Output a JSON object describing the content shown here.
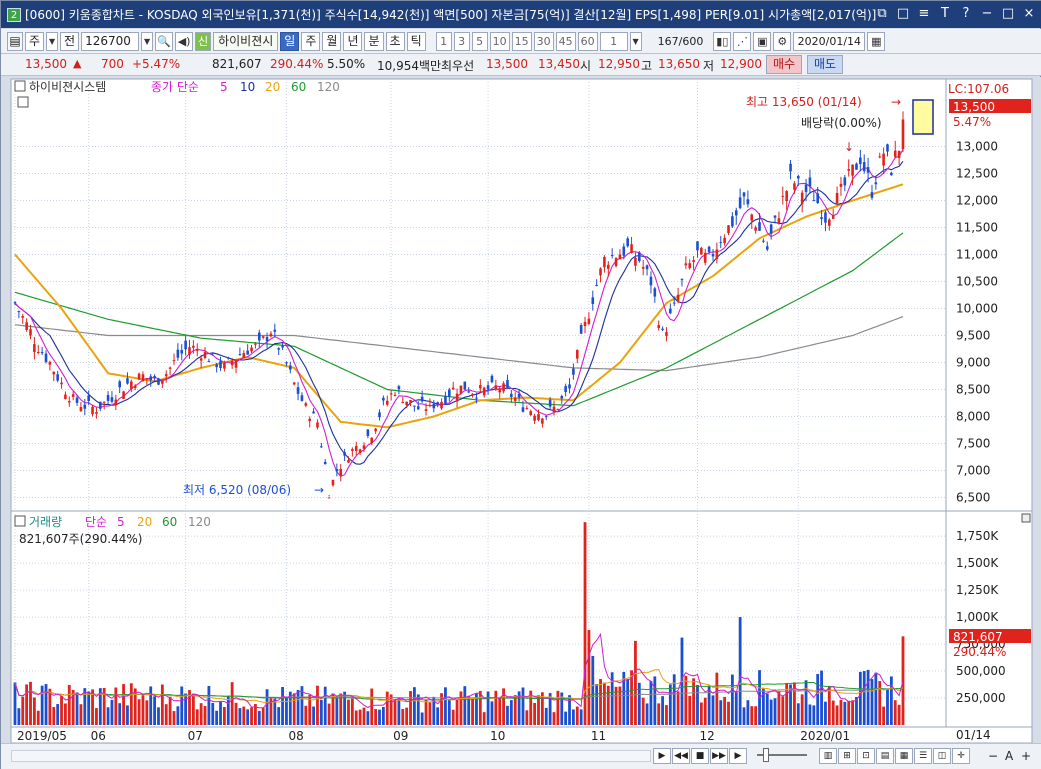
{
  "window": {
    "badge": "2",
    "title": "[0600] 키움종합차트 - KOSDAQ 외국인보유[1,371(천)] 주식수[14,942(천)] 액면[500] 자본금[75(억)] 결산[12월] EPS[1,498] PER[9.01] 시가총액[2,017(억)]",
    "buttons": [
      "⧉",
      "□",
      "≡",
      "T",
      "?",
      "−",
      "□",
      "×"
    ]
  },
  "toolbar": {
    "period_label": "주",
    "prev_label": "전",
    "stock_code": "126700",
    "search_icon": "search-icon",
    "sound_icon": "speaker-icon",
    "sin_label": "신",
    "stock_name": "하이비젼시",
    "interval_tabs": [
      "일",
      "주",
      "월",
      "년",
      "분",
      "초",
      "틱"
    ],
    "interval_selected": "일",
    "numbers": [
      "1",
      "3",
      "5",
      "10",
      "15",
      "30",
      "45",
      "60"
    ],
    "count_value": "1",
    "page_value": "167",
    "page_total": "/600",
    "date_value": "2020/01/14"
  },
  "quote": {
    "price": "13,500",
    "change": "700",
    "change_pct": "+5.47%",
    "volume": "821,607",
    "volume_ratio": "290.44%",
    "turnover": "5.50%",
    "amount": "10,954백만",
    "best_offer_label": "최우선",
    "best_ask": "13,500",
    "best_bid": "13,450",
    "open_label": "시",
    "open": "12,950",
    "high_label": "고",
    "high": "13,650",
    "low_label": "저",
    "low": "12,900",
    "buy_label": "매수",
    "sell_label": "매도"
  },
  "price_panel": {
    "legend_stock": "하이비젼시스템",
    "legend_ma_title": "종가 단순",
    "legend_ma": [
      "5",
      "10",
      "20",
      "60",
      "120"
    ],
    "lc_label": "LC:107.06",
    "current_price": "13,500",
    "current_pct": "5.47%",
    "high_annot": "최고 13,650 (01/14)",
    "low_annot": "최저 6,520 (08/06)",
    "dividend_annot": "배당락(0.00%)"
  },
  "volume_panel": {
    "legend_title": "거래량",
    "legend_ma_title": "단순",
    "legend_ma": [
      "5",
      "20",
      "60",
      "120"
    ],
    "current_text": "821,607주(290.44%)",
    "current_volume": "821,607",
    "current_pct": "290.44%"
  },
  "bottom": {
    "date_label": "01/14",
    "zoom_minus": "−",
    "zoom_plus": "+",
    "text_a": "A"
  },
  "colors": {
    "up": "#e0231c",
    "down": "#1c4fd0",
    "ma5": "#d21fd2",
    "ma10": "#1c2f9e",
    "ma20": "#e9a30c",
    "ma60": "#1e9a2e",
    "ma120": "#8a8a8a",
    "grid": "#c8d4e6",
    "bg": "#ffffff"
  },
  "chart_data": [
    {
      "type": "candlestick",
      "title": "하이비젼시스템",
      "x_ticks": [
        "2019/05",
        "06",
        "07",
        "08",
        "09",
        "10",
        "11",
        "12",
        "2020/01"
      ],
      "ylim": [
        6250,
        14250
      ],
      "y_ticks": [
        6500,
        7000,
        7500,
        8000,
        8500,
        9000,
        9500,
        10000,
        10500,
        11000,
        11500,
        12000,
        12500,
        13000
      ],
      "grid": true,
      "series_names": [
        "종가 단순 5",
        "10",
        "20",
        "60",
        "120"
      ],
      "close_path": [
        [
          0,
          10100
        ],
        [
          3,
          9700
        ],
        [
          6,
          9300
        ],
        [
          9,
          9000
        ],
        [
          12,
          8600
        ],
        [
          15,
          8300
        ],
        [
          18,
          8200
        ],
        [
          21,
          8150
        ],
        [
          24,
          8300
        ],
        [
          27,
          8500
        ],
        [
          30,
          8650
        ],
        [
          33,
          8750
        ],
        [
          36,
          8650
        ],
        [
          39,
          8800
        ],
        [
          42,
          9100
        ],
        [
          45,
          9300
        ],
        [
          48,
          9200
        ],
        [
          51,
          9050
        ],
        [
          54,
          8900
        ],
        [
          57,
          9100
        ],
        [
          60,
          9250
        ],
        [
          63,
          9300
        ],
        [
          66,
          9600
        ],
        [
          69,
          9150
        ],
        [
          72,
          8600
        ],
        [
          75,
          8150
        ],
        [
          78,
          7900
        ],
        [
          80,
          7100
        ],
        [
          81,
          6600
        ],
        [
          83,
          7000
        ],
        [
          86,
          7300
        ],
        [
          89,
          7500
        ],
        [
          92,
          7700
        ],
        [
          95,
          8200
        ],
        [
          98,
          8500
        ],
        [
          101,
          8300
        ],
        [
          104,
          8150
        ],
        [
          107,
          8200
        ],
        [
          110,
          8300
        ],
        [
          113,
          8500
        ],
        [
          116,
          8550
        ],
        [
          119,
          8450
        ],
        [
          122,
          8500
        ],
        [
          125,
          8550
        ],
        [
          128,
          8400
        ],
        [
          131,
          8200
        ],
        [
          134,
          8100
        ],
        [
          137,
          8050
        ],
        [
          140,
          8200
        ],
        [
          143,
          8500
        ],
        [
          146,
          9400
        ],
        [
          149,
          10200
        ],
        [
          152,
          10900
        ],
        [
          155,
          11000
        ],
        [
          158,
          11100
        ],
        [
          161,
          10900
        ],
        [
          164,
          10500
        ],
        [
          167,
          9500
        ],
        [
          170,
          10000
        ],
        [
          173,
          10700
        ],
        [
          176,
          11000
        ],
        [
          179,
          10900
        ],
        [
          182,
          11300
        ],
        [
          185,
          11600
        ],
        [
          188,
          12000
        ],
        [
          191,
          11600
        ],
        [
          194,
          11100
        ],
        [
          197,
          11800
        ],
        [
          200,
          12400
        ],
        [
          203,
          12200
        ],
        [
          206,
          12100
        ],
        [
          209,
          11700
        ],
        [
          212,
          12000
        ],
        [
          215,
          12400
        ],
        [
          218,
          12800
        ],
        [
          221,
          12200
        ],
        [
          224,
          12900
        ],
        [
          226,
          12600
        ],
        [
          228,
          13000
        ],
        [
          229,
          13500
        ]
      ],
      "ma_paths": {
        "ma20": [
          [
            0,
            11000
          ],
          [
            12,
            10000
          ],
          [
            24,
            8800
          ],
          [
            36,
            8650
          ],
          [
            48,
            8900
          ],
          [
            60,
            9100
          ],
          [
            72,
            8900
          ],
          [
            84,
            7900
          ],
          [
            96,
            7800
          ],
          [
            108,
            8000
          ],
          [
            120,
            8300
          ],
          [
            132,
            8350
          ],
          [
            144,
            8300
          ],
          [
            156,
            9000
          ],
          [
            168,
            10100
          ],
          [
            180,
            10600
          ],
          [
            192,
            11300
          ],
          [
            204,
            11700
          ],
          [
            216,
            12000
          ],
          [
            229,
            12300
          ]
        ],
        "ma60": [
          [
            0,
            10300
          ],
          [
            24,
            9800
          ],
          [
            48,
            9450
          ],
          [
            72,
            9300
          ],
          [
            96,
            8500
          ],
          [
            120,
            8300
          ],
          [
            144,
            8200
          ],
          [
            168,
            8900
          ],
          [
            192,
            9800
          ],
          [
            216,
            10700
          ],
          [
            229,
            11400
          ]
        ],
        "ma120": [
          [
            0,
            9700
          ],
          [
            24,
            9500
          ],
          [
            48,
            9500
          ],
          [
            72,
            9500
          ],
          [
            96,
            9300
          ],
          [
            120,
            9100
          ],
          [
            144,
            8900
          ],
          [
            168,
            8850
          ],
          [
            192,
            9100
          ],
          [
            216,
            9500
          ],
          [
            229,
            9850
          ]
        ]
      },
      "highest": {
        "label": "최고 13,650 (01/14)",
        "value": 13650
      },
      "lowest": {
        "label": "최저 6,520 (08/06)",
        "value": 6520
      }
    },
    {
      "type": "bar",
      "title": "거래량",
      "ylim": [
        0,
        1900000
      ],
      "y_ticks": [
        250000,
        500000,
        750000,
        1000000,
        1250000,
        1500000,
        1750000
      ],
      "y_tick_labels": [
        "250,000",
        "500,000",
        "750,000",
        "1,000K",
        "1,250K",
        "1,500K",
        "1,750K"
      ],
      "notable_bars": [
        {
          "x": 147,
          "value": 1880000
        },
        {
          "x": 148,
          "value": 880000
        },
        {
          "x": 149,
          "value": 640000
        },
        {
          "x": 160,
          "value": 780000
        },
        {
          "x": 172,
          "value": 810000
        },
        {
          "x": 187,
          "value": 1000000
        },
        {
          "x": 229,
          "value": 821607
        }
      ],
      "baseline_volume": 230000
    }
  ]
}
